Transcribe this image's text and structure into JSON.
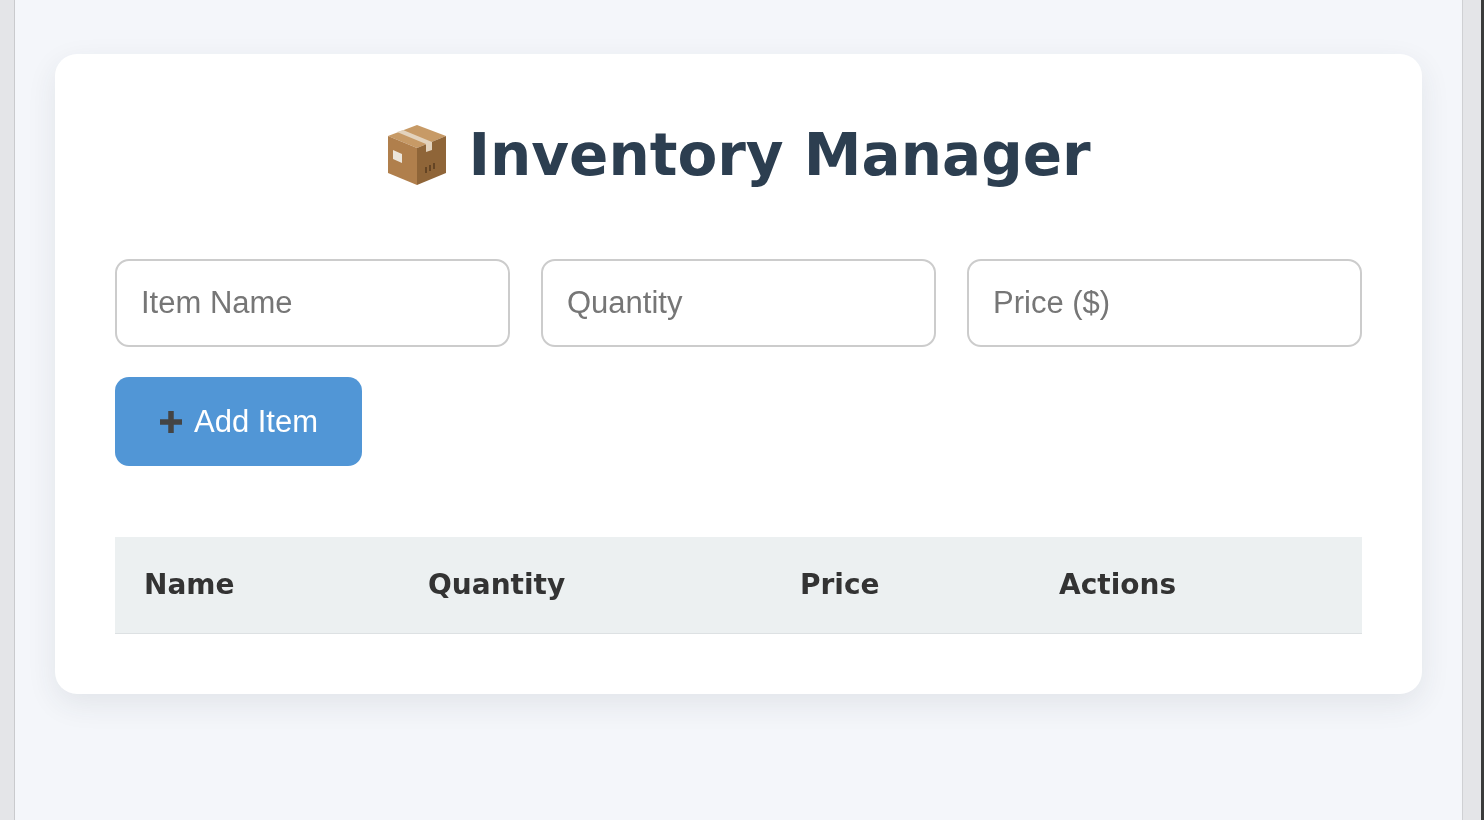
{
  "title": {
    "text": "Inventory Manager"
  },
  "form": {
    "fields": [
      {
        "placeholder": "Item Name"
      },
      {
        "placeholder": "Quantity"
      },
      {
        "placeholder": "Price ($)"
      }
    ],
    "add_button": {
      "label": "Add Item"
    }
  },
  "table": {
    "columns": [
      "Name",
      "Quantity",
      "Price",
      "Actions"
    ]
  }
}
